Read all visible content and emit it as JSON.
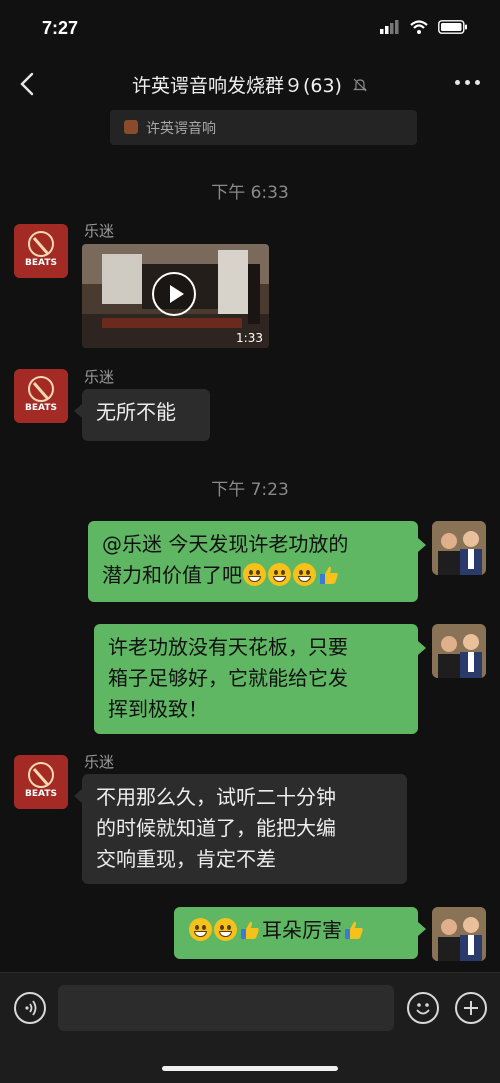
{
  "status_bar": {
    "time": "7:27"
  },
  "nav": {
    "title": "许英谔音响发烧群９(63)"
  },
  "pinned": {
    "text": "许英谔音响"
  },
  "messages": [
    {
      "type": "time",
      "text": "下午 6:33"
    },
    {
      "type": "video",
      "sender": "乐迷",
      "duration": "1:33"
    },
    {
      "type": "text",
      "sender": "乐迷",
      "text": "无所不能"
    },
    {
      "type": "time",
      "text": "下午 7:23"
    },
    {
      "type": "text_out",
      "lines": [
        "@乐迷 今天发现许老功放的",
        "潜力和价值了吧"
      ]
    },
    {
      "type": "text_out",
      "lines": [
        "许老功放没有天花板，只要",
        "箱子足够好，它就能给它发",
        "挥到极致！"
      ]
    },
    {
      "type": "text",
      "sender": "乐迷",
      "lines": [
        "不用那么久，试听二十分钟",
        "的时候就知道了，能把大编",
        "交响重现，肯定不差"
      ]
    },
    {
      "type": "text_out",
      "text": "耳朵厉害"
    }
  ],
  "avatar_label": "BEATS",
  "colors": {
    "accent_green": "#5fb663",
    "bubble_in": "#2c2c2c",
    "background": "#111111"
  },
  "icons": [
    "back-chevron-icon",
    "mute-bell-icon",
    "more-icon",
    "voice-icon",
    "emoji-icon",
    "add-icon",
    "signal-icon",
    "wifi-icon",
    "battery-icon"
  ]
}
